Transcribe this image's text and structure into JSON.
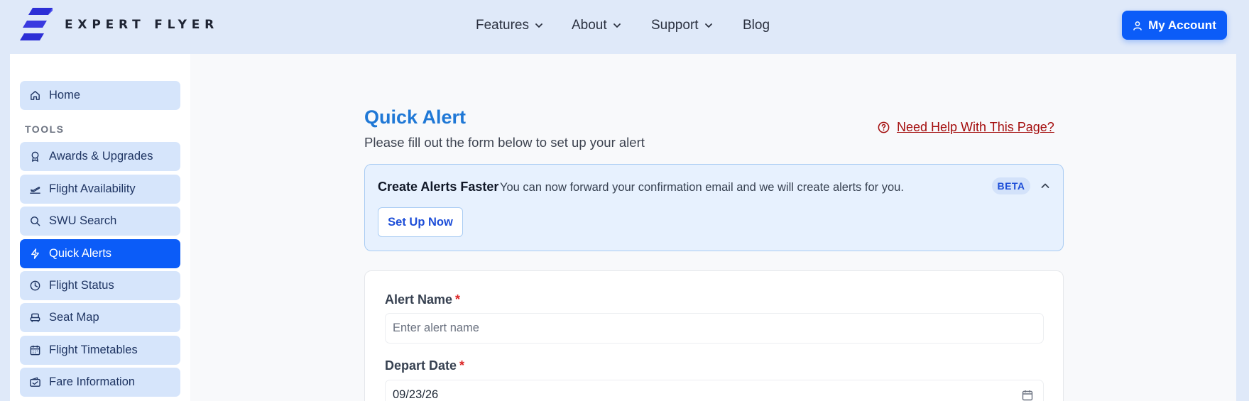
{
  "brand": {
    "name": "EXPERT FLYER"
  },
  "nav": {
    "items": [
      {
        "label": "Features",
        "has_dropdown": true
      },
      {
        "label": "About",
        "has_dropdown": true
      },
      {
        "label": "Support",
        "has_dropdown": true
      },
      {
        "label": "Blog",
        "has_dropdown": false
      }
    ],
    "account_label": "My Account"
  },
  "sidebar": {
    "home_label": "Home",
    "section_label": "TOOLS",
    "items": [
      {
        "label": "Awards & Upgrades",
        "icon": "award-icon"
      },
      {
        "label": "Flight Availability",
        "icon": "plane-takeoff-icon"
      },
      {
        "label": "SWU Search",
        "icon": "search-icon"
      },
      {
        "label": "Quick Alerts",
        "icon": "lightning-icon",
        "active": true
      },
      {
        "label": "Flight Status",
        "icon": "clock-icon"
      },
      {
        "label": "Seat Map",
        "icon": "seat-icon"
      },
      {
        "label": "Flight Timetables",
        "icon": "calendar-icon"
      },
      {
        "label": "Fare Information",
        "icon": "ticket-icon"
      }
    ]
  },
  "page": {
    "title": "Quick Alert",
    "subtitle": "Please fill out the form below to set up your alert",
    "help_link": "Need Help With This Page?"
  },
  "banner": {
    "title": "Create Alerts Faster",
    "text": "You can now forward your confirmation email and we will create alerts for you.",
    "badge": "BETA",
    "button_label": "Set Up Now"
  },
  "form": {
    "alert_name": {
      "label": "Alert Name",
      "required_mark": "*",
      "placeholder": "Enter alert name",
      "value": ""
    },
    "depart_date": {
      "label": "Depart Date",
      "required_mark": "*",
      "value": "09/23/26"
    }
  },
  "colors": {
    "accent": "#0b5cf8",
    "title_blue": "#1f78d6",
    "help_red": "#a40e0e",
    "sidebar_item_bg": "#d6e5fb",
    "page_bg": "#dfe9f9"
  }
}
